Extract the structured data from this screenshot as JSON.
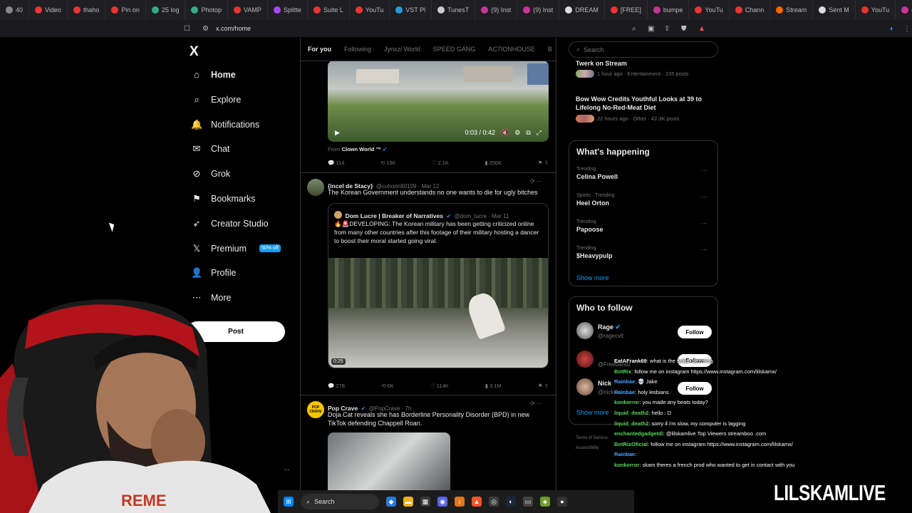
{
  "browser": {
    "tabs": [
      "40",
      "Video",
      "thaho",
      "Pin on",
      "25 log",
      "Photop",
      "VAMP",
      "Splitte",
      "Suite L",
      "YouTu",
      "VST Pl",
      "TunesT",
      "(9) Inst",
      "(9) Inst",
      "DREAM",
      "[FREE]",
      "bumpe",
      "YouTu",
      "Chann",
      "Stream",
      "Sent M",
      "YouTu",
      "(3) In"
    ],
    "url": "x.com/home"
  },
  "nav": {
    "logo": "X",
    "items": [
      {
        "label": "Home",
        "icon": "home-icon"
      },
      {
        "label": "Explore",
        "icon": "search-icon"
      },
      {
        "label": "Notifications",
        "icon": "bell-icon"
      },
      {
        "label": "Chat",
        "icon": "envelope-icon"
      },
      {
        "label": "Grok",
        "icon": "grok-icon"
      },
      {
        "label": "Bookmarks",
        "icon": "bookmark-icon"
      },
      {
        "label": "Creator Studio",
        "icon": "rocket-icon"
      },
      {
        "label": "Premium",
        "icon": "x-icon"
      },
      {
        "label": "Profile",
        "icon": "person-icon"
      },
      {
        "label": "More",
        "icon": "more-icon"
      }
    ],
    "premium_badge": "50% off",
    "post_button": "Post",
    "overflow": "..."
  },
  "feed": {
    "tabs": [
      "For you",
      "Following",
      "Jynxzi World",
      "SPEED GANG",
      "AC7IONHOUSE",
      "B"
    ],
    "tweet1": {
      "video_time": "0:03 / 0:42",
      "from_label": "From",
      "from_account": "Clown World ™",
      "replies": "114",
      "reposts": "190",
      "likes": "2.1K",
      "views": "250K"
    },
    "tweet2": {
      "name": "{incel de Stacy}",
      "handle": "@cuhorin90109 · Mar 12",
      "text": "The Korean Government understands no one wants to die for ugly bitches",
      "quote_name": "Dom Lucre | Breaker of Narratives",
      "quote_handle": "@dom_lucre · Mar 11",
      "quote_text": "DEVELOPING: The Korean military has been getting criticized online from many other countries after this footage of their military hosting a dancer to boost their moral started going viral.",
      "duration": "0:25",
      "replies": "278",
      "reposts": "6K",
      "likes": "114K",
      "views": "3.1M"
    },
    "tweet3": {
      "name": "Pop Crave",
      "handle": "@PopCrave · 7h",
      "avatar_text": "POP CRAVE",
      "text": "Doja Cat reveals she has Borderline Personality Disorder (BPD) in new TikTok defending Chappell Roan."
    }
  },
  "sidebar": {
    "search_placeholder": "Search",
    "top_stories": [
      {
        "title": "Twerk on Stream",
        "meta": "1 hour ago · Entertainment · 235 posts"
      },
      {
        "title": "Bow Wow Credits Youthful Looks at 39 to Lifelong No-Red-Meat Diet",
        "meta": "22 hours ago · Other · 42.3K posts"
      }
    ],
    "happening_title": "What's happening",
    "trends": [
      {
        "category": "Trending",
        "title": "Celina Powell"
      },
      {
        "category": "Sports · Trending",
        "title": "Heel Orton"
      },
      {
        "category": "Trending",
        "title": "Papoose"
      },
      {
        "category": "Trending",
        "title": "$Heavypulp"
      }
    ],
    "show_more": "Show more",
    "who_to_follow_title": "Who to follow",
    "follow_label": "Follow",
    "follows": [
      {
        "name": "Rage",
        "handle": "@ragecvlt"
      },
      {
        "name": "",
        "handle": "@Freebandz"
      },
      {
        "name": "Nick",
        "handle": "@nickcar"
      }
    ],
    "footer": [
      "Terms of Service",
      "Accessibility"
    ]
  },
  "chat": [
    {
      "user": "EatAFrank69",
      "msg": ": what is the twitter deeming",
      "color": "#ffffff"
    },
    {
      "user": "BotRix",
      "msg": ": follow me on instagram https://www.instagram.com/lilskamx/",
      "color": "#59d65c"
    },
    {
      "user": "Rainbae",
      "msg": ": 💀 Jake",
      "color": "#4aa3ff"
    },
    {
      "user": "Rainbae",
      "msg": ": holy lesbians",
      "color": "#4aa3ff"
    },
    {
      "user": "konkorror",
      "msg": ": you made any beats today?",
      "color": "#59d65c"
    },
    {
      "user": "liquid_death2",
      "msg": ": hello : D",
      "color": "#59d65c"
    },
    {
      "user": "liquid_death2",
      "msg": ": sorry if i'm slow, my computer is lagging",
      "color": "#59d65c"
    },
    {
      "user": "enchantedgadgetdi",
      "msg": ": @lilskamlive Top Viewers streamboo .com",
      "color": "#59d65c"
    },
    {
      "user": "BotRixOficial",
      "msg": ": follow me on instagram https://www.instagram.com/lilskamx/",
      "color": "#59d65c"
    },
    {
      "user": "Rainbae",
      "msg": ":",
      "color": "#4aa3ff"
    },
    {
      "user": "konkorror",
      "msg": ": skam theres a french prod who wanted to get in contact with you",
      "color": "#59d65c"
    }
  ],
  "taskbar": {
    "search": "Search"
  },
  "overlay_brand": "LILSKAMLIVE"
}
